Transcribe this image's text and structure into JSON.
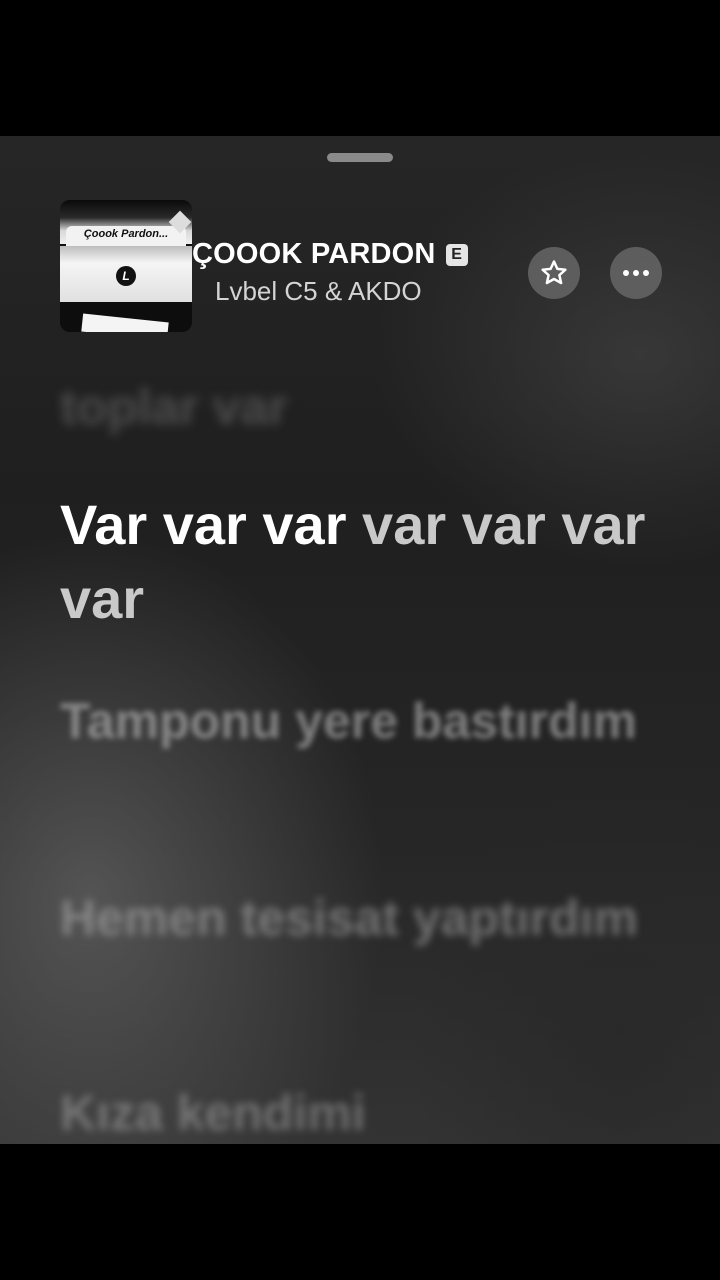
{
  "now_playing": {
    "title": "ÇOOOK PARDON",
    "explicit_badge": "E",
    "artist": "Lvbel C5 & AKDO",
    "artwork": {
      "text": "Çoook Pardon...",
      "logo_letter": "L"
    }
  },
  "controls": {
    "favorite_icon": "star-icon",
    "more_icon": "more-icon"
  },
  "lyrics": {
    "previous": "toplar var",
    "current_sung": "Var var var",
    "current_unsung": " var var var var",
    "next": [
      "Tamponu yere bastırdım",
      "Hemen tesisat yaptırdım",
      "Kıza kendimi"
    ]
  }
}
